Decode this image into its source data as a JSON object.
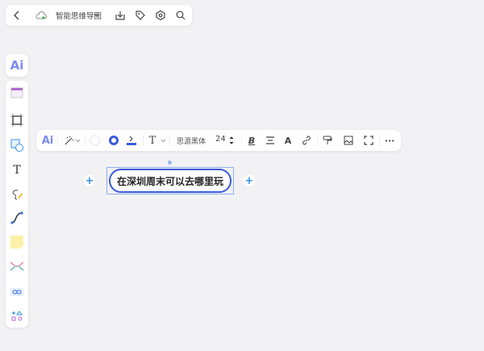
{
  "topbar": {
    "title": "智能思维导图",
    "icons": [
      "back-icon",
      "cloud-sync-icon",
      "chevron-down-icon",
      "download-icon",
      "tag-icon",
      "settings-icon",
      "search-icon"
    ]
  },
  "sidebar": {
    "ai_label": "Ai",
    "tools": [
      "template",
      "frame",
      "shape",
      "text",
      "pen",
      "connector",
      "sticky-note",
      "mindmap",
      "link",
      "more-apps"
    ],
    "text_tool_glyph": "T"
  },
  "float_toolbar": {
    "ai_label": "Ai",
    "font_name": "思源黑体",
    "font_size": "24",
    "text_glyph": "T",
    "bold_glyph": "B",
    "color_glyph": "A",
    "more_glyph": "···",
    "accent": "#3b5bdb"
  },
  "node": {
    "text": "在深圳周末可以去哪里玩",
    "border_color": "#3b5bdb"
  }
}
